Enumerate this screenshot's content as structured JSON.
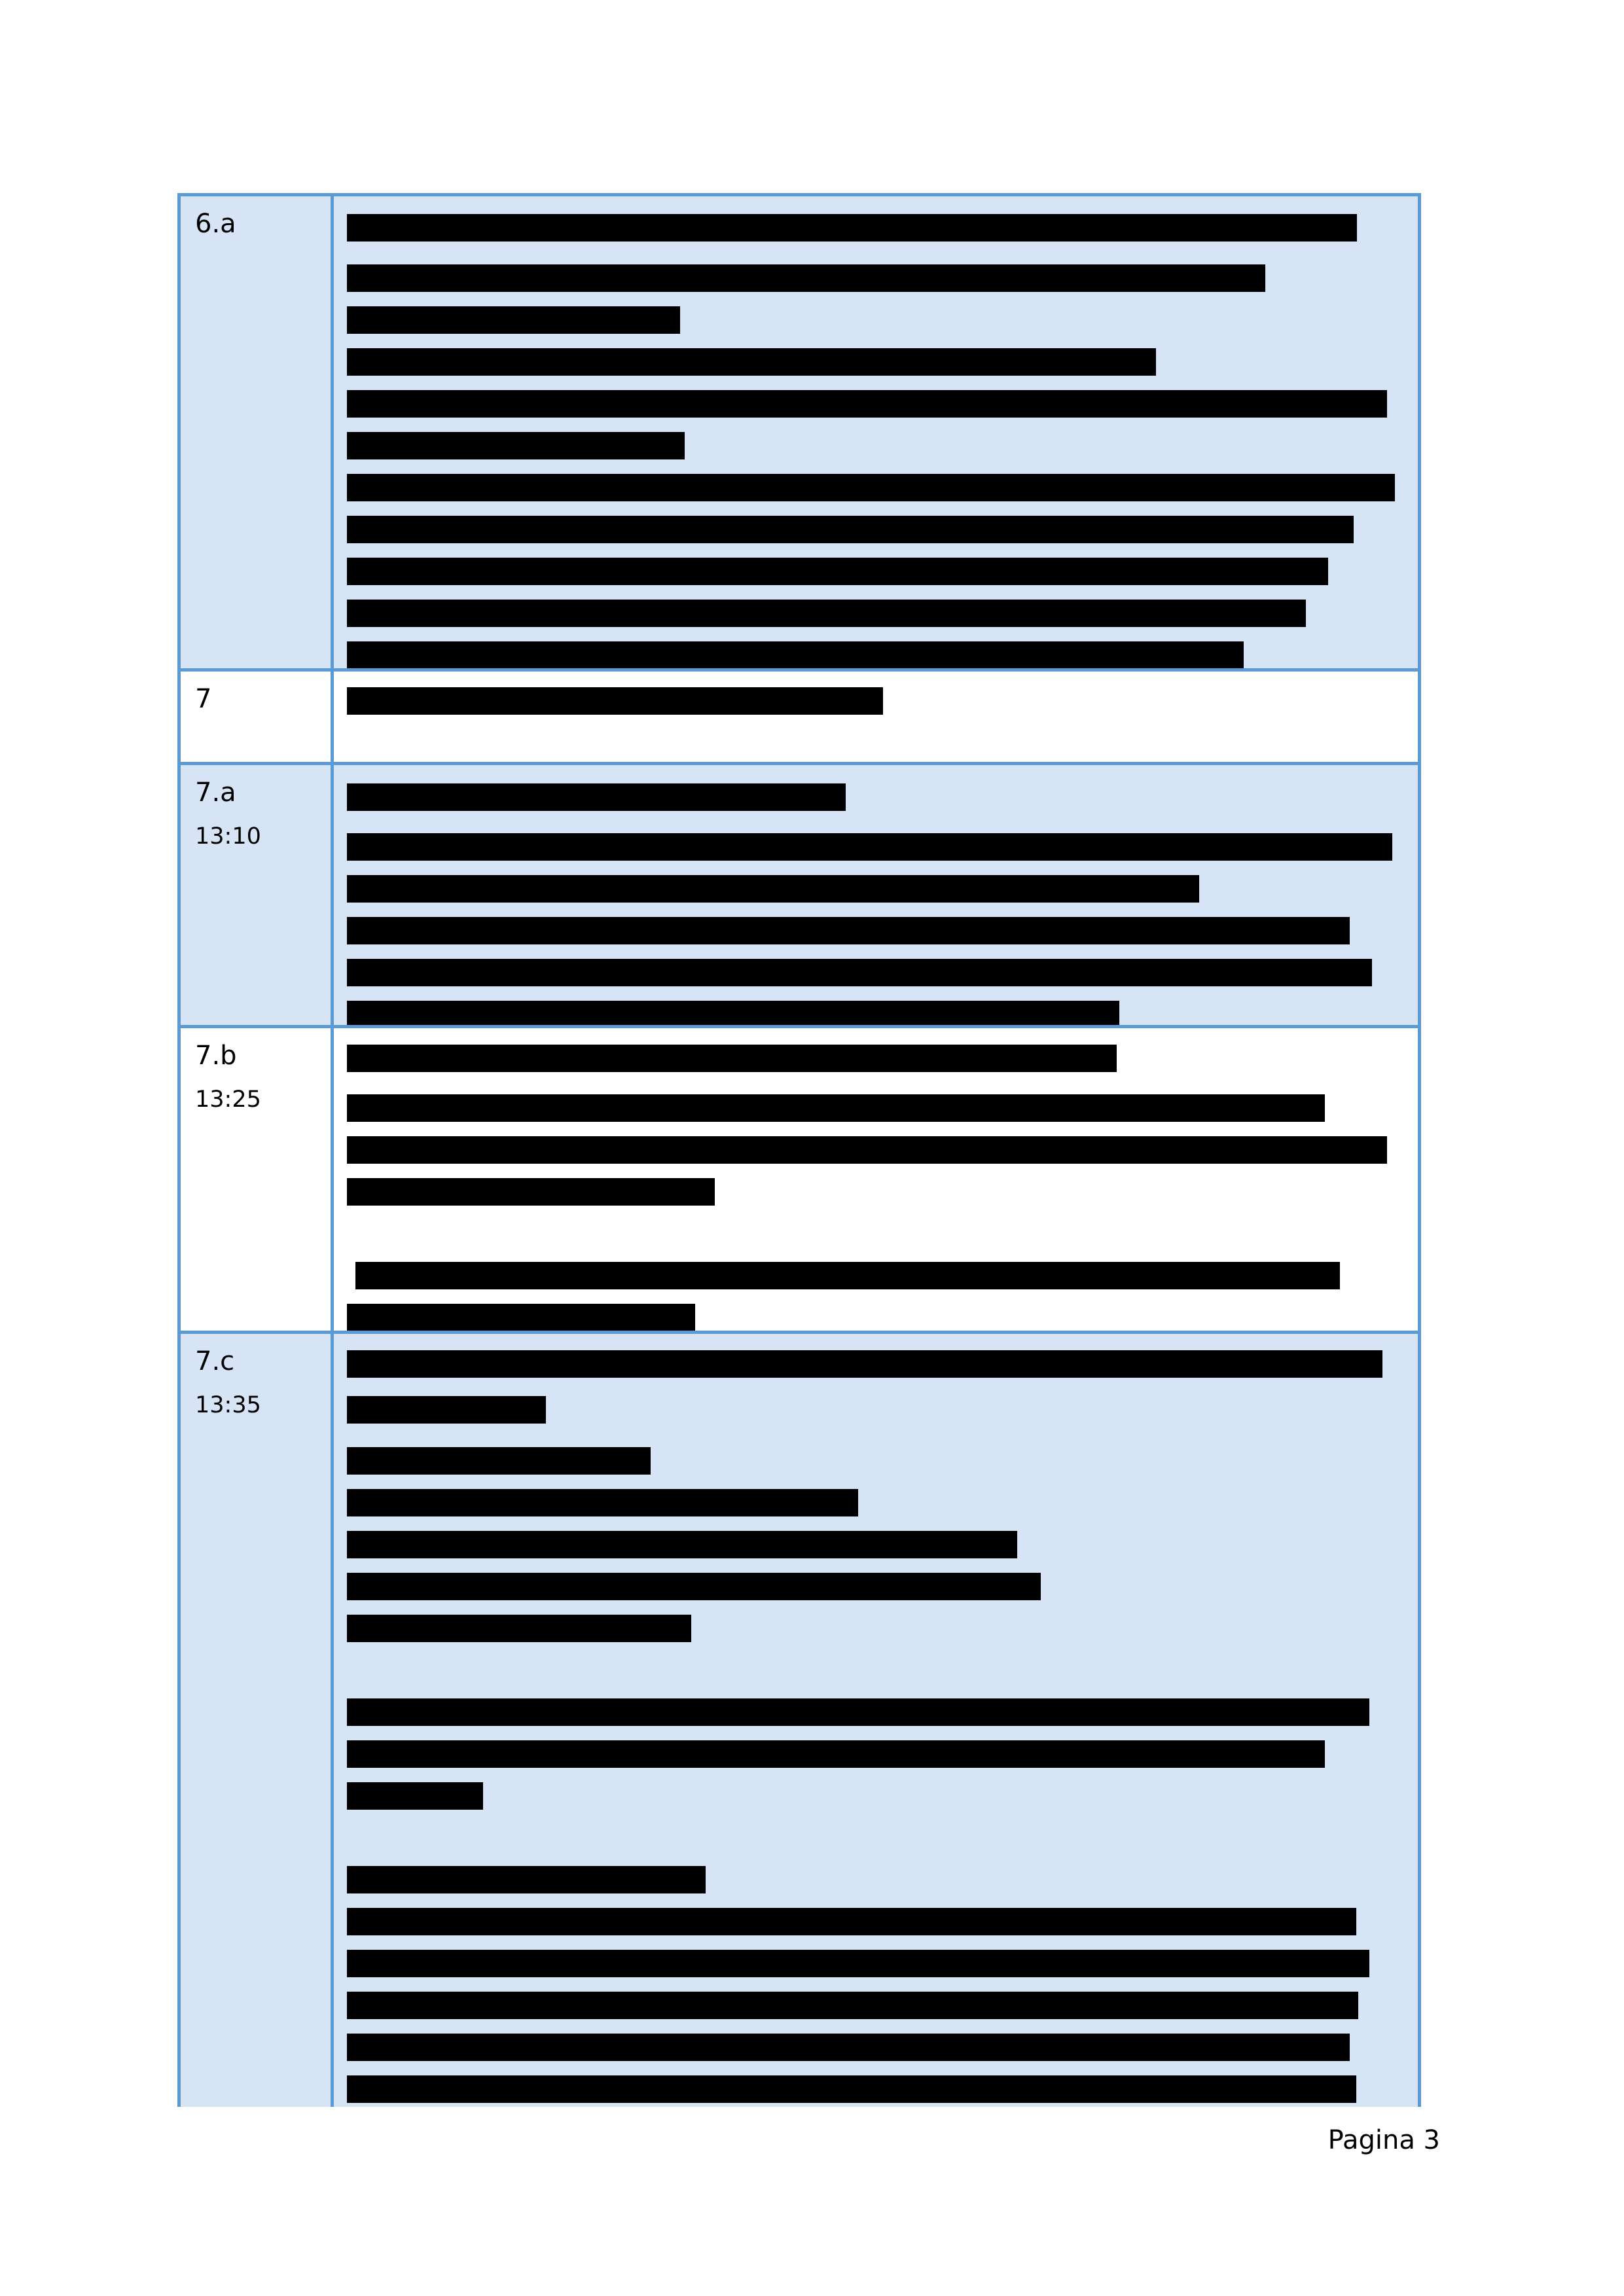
{
  "agenda": {
    "rows": [
      {
        "number": "6.a",
        "time": ""
      },
      {
        "number": "7",
        "time": ""
      },
      {
        "number": "7.a",
        "time": "13:10"
      },
      {
        "number": "7.b",
        "time": "13:25"
      },
      {
        "number": "7.c",
        "time": "13:35"
      }
    ]
  },
  "colors": {
    "border": "#5b9bd5",
    "shaded_row": "#d6e4f5",
    "redaction": "#000000"
  },
  "footer": {
    "page_label": "Pagina 3"
  }
}
